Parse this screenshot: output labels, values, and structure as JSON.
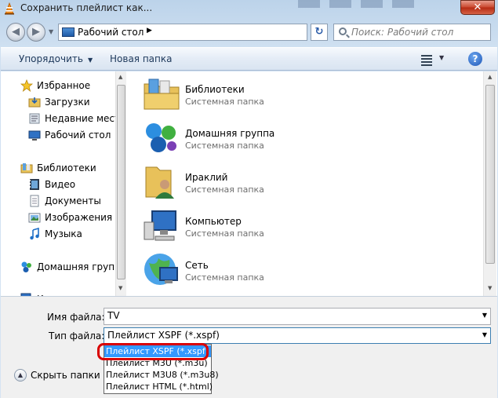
{
  "window": {
    "title": "Сохранить плейлист как..."
  },
  "address": {
    "location": "Рабочий стол"
  },
  "search": {
    "placeholder": "Поиск: Рабочий стол"
  },
  "toolbar": {
    "organize_label": "Упорядочить",
    "new_folder_label": "Новая папка"
  },
  "sidebar": {
    "items": [
      {
        "label": "Избранное",
        "icon": "star-icon"
      },
      {
        "label": "Загрузки",
        "icon": "downloads-folder-icon"
      },
      {
        "label": "Недавние места",
        "icon": "recent-places-icon"
      },
      {
        "label": "Рабочий стол",
        "icon": "desktop-icon"
      },
      {
        "label": "Библиотеки",
        "icon": "libraries-icon"
      },
      {
        "label": "Видео",
        "icon": "video-icon"
      },
      {
        "label": "Документы",
        "icon": "documents-icon"
      },
      {
        "label": "Изображения",
        "icon": "pictures-icon"
      },
      {
        "label": "Музыка",
        "icon": "music-icon"
      },
      {
        "label": "Домашняя группа",
        "icon": "homegroup-icon"
      },
      {
        "label": "К",
        "icon": "computer-icon"
      }
    ]
  },
  "content": {
    "items": [
      {
        "name": "Библиотеки",
        "sub": "Системная папка",
        "icon": "libraries-folder-icon"
      },
      {
        "name": "Домашняя группа",
        "sub": "Системная папка",
        "icon": "homegroup-icon"
      },
      {
        "name": "Ираклий",
        "sub": "Системная папка",
        "icon": "user-folder-icon"
      },
      {
        "name": "Компьютер",
        "sub": "Системная папка",
        "icon": "computer-icon"
      },
      {
        "name": "Сеть",
        "sub": "Системная папка",
        "icon": "network-icon"
      }
    ]
  },
  "form": {
    "filename_label": "Имя файла:",
    "filename_value": "TV",
    "filetype_label": "Тип файла:",
    "filetype_value": "Плейлист XSPF (*.xspf)",
    "filetype_options": [
      "Плейлист XSPF (*.xspf)",
      "Плейлист M3U (*.m3u)",
      "Плейлист M3U8 (*.m3u8)",
      "Плейлист HTML (*.html)"
    ],
    "hide_folders_label": "Скрыть папки"
  },
  "colors": {
    "selection": "#3399ff",
    "highlight_ring": "#d90000",
    "close_button": "#c9452d"
  }
}
